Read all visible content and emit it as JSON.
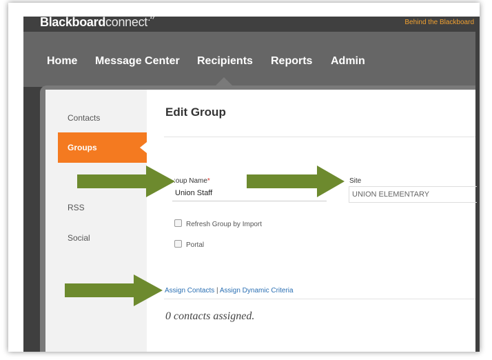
{
  "app": {
    "logo_bold": "Blackboard",
    "logo_light": "connect",
    "logo_mark": ".¹⁷",
    "tagline": "Behind the Blackboard"
  },
  "nav": {
    "items": [
      "Home",
      "Message Center",
      "Recipients",
      "Reports",
      "Admin"
    ],
    "active": "Recipients"
  },
  "sidebar": {
    "items": [
      "Contacts",
      "Groups",
      "RSS",
      "Social"
    ],
    "active": "Groups"
  },
  "page": {
    "title": "Edit Group",
    "group_name_label": ":oup Name",
    "required_marker": "*",
    "group_name_value": "Union Staff",
    "site_label": "Site",
    "site_value": "UNION ELEMENTARY",
    "checkbox_refresh": "Refresh Group by Import",
    "checkbox_portal": "Portal",
    "link_assign_contacts": "Assign Contacts",
    "link_separator": " | ",
    "link_assign_dynamic": "Assign Dynamic Criteria",
    "contacts_count": "0 contacts assigned."
  },
  "colors": {
    "accent_orange": "#f47a20",
    "arrow_green": "#6d8a2e",
    "nav_bg": "#666666",
    "link_blue": "#2a6fb3"
  }
}
